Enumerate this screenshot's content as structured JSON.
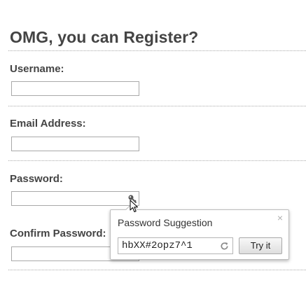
{
  "page": {
    "title": "OMG, you can Register?"
  },
  "form": {
    "username_label": "Username:",
    "username_value": "",
    "email_label": "Email Address:",
    "email_value": "",
    "password_label": "Password:",
    "password_value": "",
    "confirm_label": "Confirm Password:",
    "confirm_value": ""
  },
  "popup": {
    "title": "Password Suggestion",
    "close_glyph": "×",
    "suggested_password": "hbXX#2opz7^1",
    "try_label": "Try it"
  },
  "icons": {
    "key": "key-icon",
    "refresh": "refresh-icon",
    "close": "close-icon",
    "cursor": "cursor-icon"
  },
  "colors": {
    "text": "#444444",
    "divider": "#aaaaaa",
    "popup_border": "#bdbdbd"
  }
}
